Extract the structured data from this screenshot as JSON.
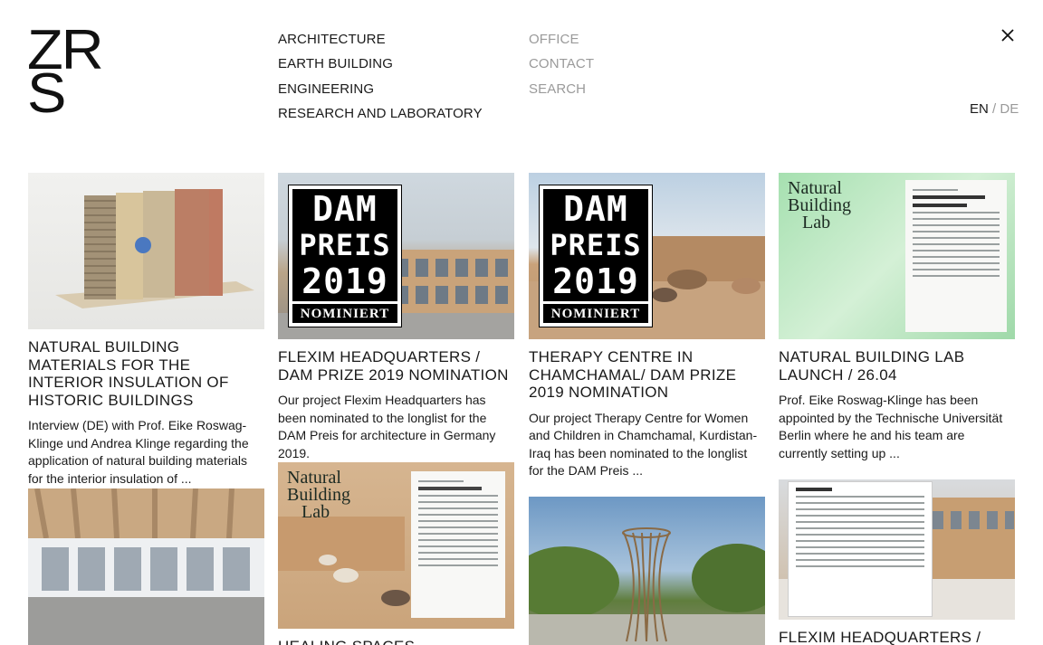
{
  "logo": {
    "line1": "ZR",
    "line2": "S"
  },
  "nav": {
    "left": [
      "ARCHITECTURE",
      "EARTH BUILDING",
      "ENGINEERING",
      "RESEARCH AND LABORATORY"
    ],
    "right": [
      "OFFICE",
      "CONTACT",
      "SEARCH"
    ]
  },
  "lang": {
    "en": "EN",
    "sep": "/",
    "de": "DE"
  },
  "dam": {
    "line1": "DAM",
    "line2": "PREIS",
    "line3": "2019",
    "nominiert": "NOMINIERT"
  },
  "nbl": {
    "line1": "Natural",
    "line2": "Building",
    "line3": "Lab"
  },
  "cards": {
    "c1": {
      "title": "NATURAL BUILDING MATERIALS FOR THE INTERIOR INSULATION OF HISTORIC BUILDINGS",
      "text": "Interview (DE) with Prof. Eike Roswag-Klinge und Andrea Klinge regarding the application of natural building materials for the interior insulation of ..."
    },
    "c2": {
      "title": "FLEXIM HEADQUARTERS / DAM PRIZE 2019 NOMINATION",
      "text": "Our project Flexim Headquarters has been nominated to the longlist for the DAM Preis for architecture in Germany 2019."
    },
    "c3": {
      "title": "THERAPY CENTRE IN CHAMCHAMAL/ DAM PRIZE 2019 NOMINATION",
      "text": "Our project Therapy Centre for Women and Children in Chamchamal, Kurdistan-Iraq has been nominated to the longlist for the DAM Preis ..."
    },
    "c4": {
      "title": "NATURAL BUILDING LAB LAUNCH / 26.04",
      "text": "Prof. Eike Roswag-Klinge has been appointed by the Technische Universität Berlin where he and his team are currently setting up ..."
    },
    "c6": {
      "title": "HEALING SPACES SYMPOSIUM /"
    },
    "c8": {
      "title": "FLEXIM HEADQUARTERS /"
    }
  }
}
